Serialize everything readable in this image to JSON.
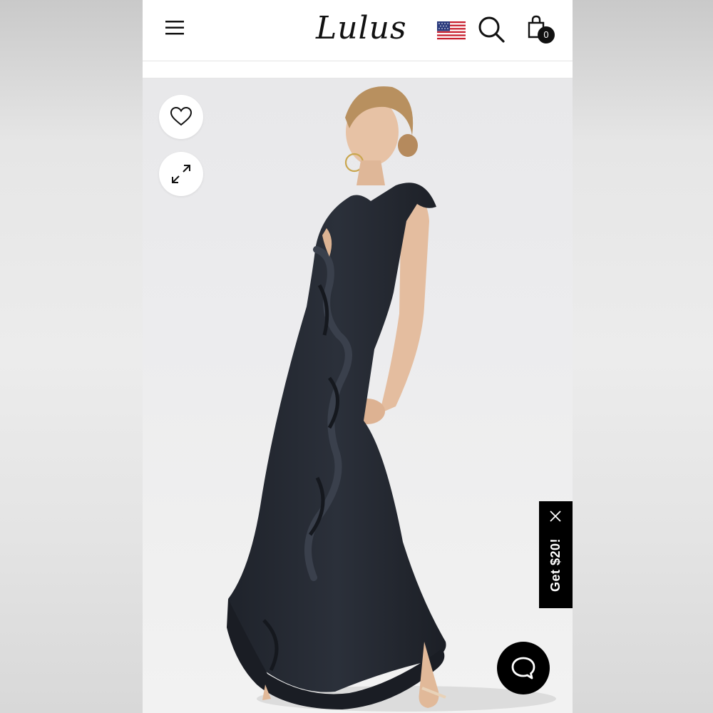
{
  "header": {
    "menu_icon": "hamburger-menu-icon",
    "logo_text": "Lulus",
    "flag_icon": "us-flag-icon",
    "search_icon": "search-icon",
    "bag_icon": "shopping-bag-icon",
    "bag_count": "0"
  },
  "product_image": {
    "wishlist_icon": "heart-icon",
    "expand_icon": "expand-arrows-icon"
  },
  "promo": {
    "label": "Get $20!",
    "close_icon": "close-icon"
  },
  "chat": {
    "icon": "chat-bubble-icon"
  },
  "colors": {
    "dress": "#262a33",
    "backdrop": "#ebebeb",
    "promo_bg": "#000000"
  }
}
